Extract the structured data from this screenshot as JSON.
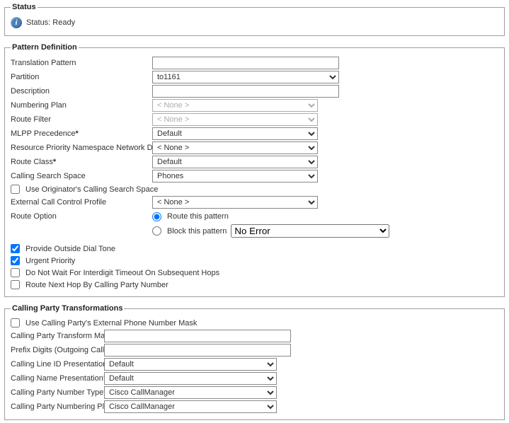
{
  "status": {
    "legend": "Status",
    "text": "Status: Ready"
  },
  "pattern_def": {
    "legend": "Pattern Definition",
    "translation_pattern": {
      "label": "Translation Pattern",
      "value": ""
    },
    "partition": {
      "label": "Partition",
      "value": "to1161"
    },
    "description": {
      "label": "Description",
      "value": ""
    },
    "numbering_plan": {
      "label": "Numbering Plan",
      "value": "< None >"
    },
    "route_filter": {
      "label": "Route Filter",
      "value": "< None >"
    },
    "mlpp_precedence": {
      "label": "MLPP Precedence",
      "value": "Default"
    },
    "rpnnd": {
      "label": "Resource Priority Namespace Network Domain",
      "value": "< None >"
    },
    "route_class": {
      "label": "Route Class",
      "value": "Default"
    },
    "calling_search_space": {
      "label": "Calling Search Space",
      "value": "Phones"
    },
    "use_originator_css": {
      "label": "Use Originator's Calling Search Space",
      "checked": false
    },
    "external_call_control_profile": {
      "label": "External Call Control Profile",
      "value": "< None >"
    },
    "route_option": {
      "label": "Route Option",
      "route_label": "Route this pattern",
      "block_label": "Block this pattern",
      "block_value": "No Error"
    },
    "provide_outside_dial_tone": {
      "label": "Provide Outside Dial Tone",
      "checked": true
    },
    "urgent_priority": {
      "label": "Urgent Priority",
      "checked": true
    },
    "no_wait_interdigit": {
      "label": "Do Not Wait For Interdigit Timeout On Subsequent Hops",
      "checked": false
    },
    "route_next_hop": {
      "label": "Route Next Hop By Calling Party Number",
      "checked": false
    }
  },
  "cpt": {
    "legend": "Calling Party Transformations",
    "use_external_mask": {
      "label": "Use Calling Party's External Phone Number Mask",
      "checked": false
    },
    "transform_mask": {
      "label": "Calling Party Transform Mask",
      "value": ""
    },
    "prefix_digits": {
      "label": "Prefix Digits (Outgoing Calls)",
      "value": ""
    },
    "line_id_presentation": {
      "label": "Calling Line ID Presentation",
      "value": "Default"
    },
    "name_presentation": {
      "label": "Calling Name Presentation",
      "value": "Default"
    },
    "number_type": {
      "label": "Calling Party Number Type",
      "value": "Cisco CallManager"
    },
    "numbering_plan": {
      "label": "Calling Party Numbering Plan",
      "value": "Cisco CallManager"
    }
  }
}
